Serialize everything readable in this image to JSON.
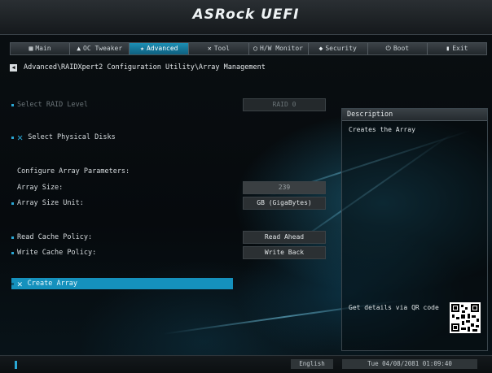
{
  "header": {
    "logo_text": "ASRock UEFI"
  },
  "tabs": [
    {
      "label": "Main",
      "icon": "grid-icon",
      "glyph": "▦"
    },
    {
      "label": "OC Tweaker",
      "icon": "rocket-icon",
      "glyph": "▲"
    },
    {
      "label": "Advanced",
      "icon": "star-icon",
      "glyph": "★",
      "active": true
    },
    {
      "label": "Tool",
      "icon": "tools-icon",
      "glyph": "✕"
    },
    {
      "label": "H/W Monitor",
      "icon": "monitor-icon",
      "glyph": "◯"
    },
    {
      "label": "Security",
      "icon": "shield-icon",
      "glyph": "◆"
    },
    {
      "label": "Boot",
      "icon": "power-icon",
      "glyph": "⏻"
    },
    {
      "label": "Exit",
      "icon": "exit-icon",
      "glyph": "▮"
    }
  ],
  "breadcrumb": {
    "back_icon": "back-arrow-icon",
    "path": "Advanced\\RAIDXpert2 Configuration Utility\\Array Management"
  },
  "settings": {
    "raid_level": {
      "label": "Select RAID Level",
      "value": "RAID 0"
    },
    "physical_disks": {
      "label": "Select Physical Disks",
      "icon": "tools-icon"
    },
    "configure_header": "Configure Array Parameters:",
    "array_size": {
      "label": "Array Size:",
      "value": "239"
    },
    "array_size_unit": {
      "label": "Array Size Unit:",
      "value": "GB (GigaBytes)"
    },
    "read_cache": {
      "label": "Read Cache Policy:",
      "value": "Read Ahead"
    },
    "write_cache": {
      "label": "Write Cache Policy:",
      "value": "Write Back"
    },
    "create_array": {
      "label": "Create Array",
      "icon": "tools-icon"
    }
  },
  "description": {
    "title": "Description",
    "text": "Creates the Array",
    "qr_text": "Get details via QR code",
    "qr_icon": "qr-code-icon"
  },
  "footer": {
    "language": "English",
    "datetime": "Tue 04/08/2081 01:09:40"
  },
  "colors": {
    "accent": "#1591bd",
    "background": "#05090c"
  }
}
